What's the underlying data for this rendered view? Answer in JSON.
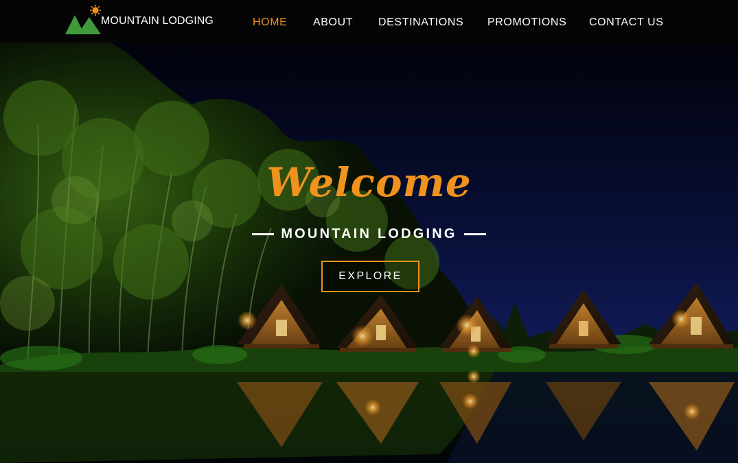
{
  "brand": {
    "name": "MOUNTAIN LODGING",
    "colors": {
      "accent": "#f0921e",
      "mountain_green": "#3f9b3a",
      "sun": "#f0921e",
      "nav_bg": "#050505"
    }
  },
  "nav": {
    "items": [
      {
        "label": "HOME",
        "active": true
      },
      {
        "label": "ABOUT",
        "active": false
      },
      {
        "label": "DESTINATIONS",
        "active": false
      },
      {
        "label": "PROMOTIONS",
        "active": false
      },
      {
        "label": "CONTACT US",
        "active": false
      }
    ]
  },
  "hero": {
    "welcome": "Welcome",
    "subtitle": "MOUNTAIN LODGING",
    "cta_label": "EXPLORE",
    "background": "night-forest-cabins-lake-image"
  }
}
